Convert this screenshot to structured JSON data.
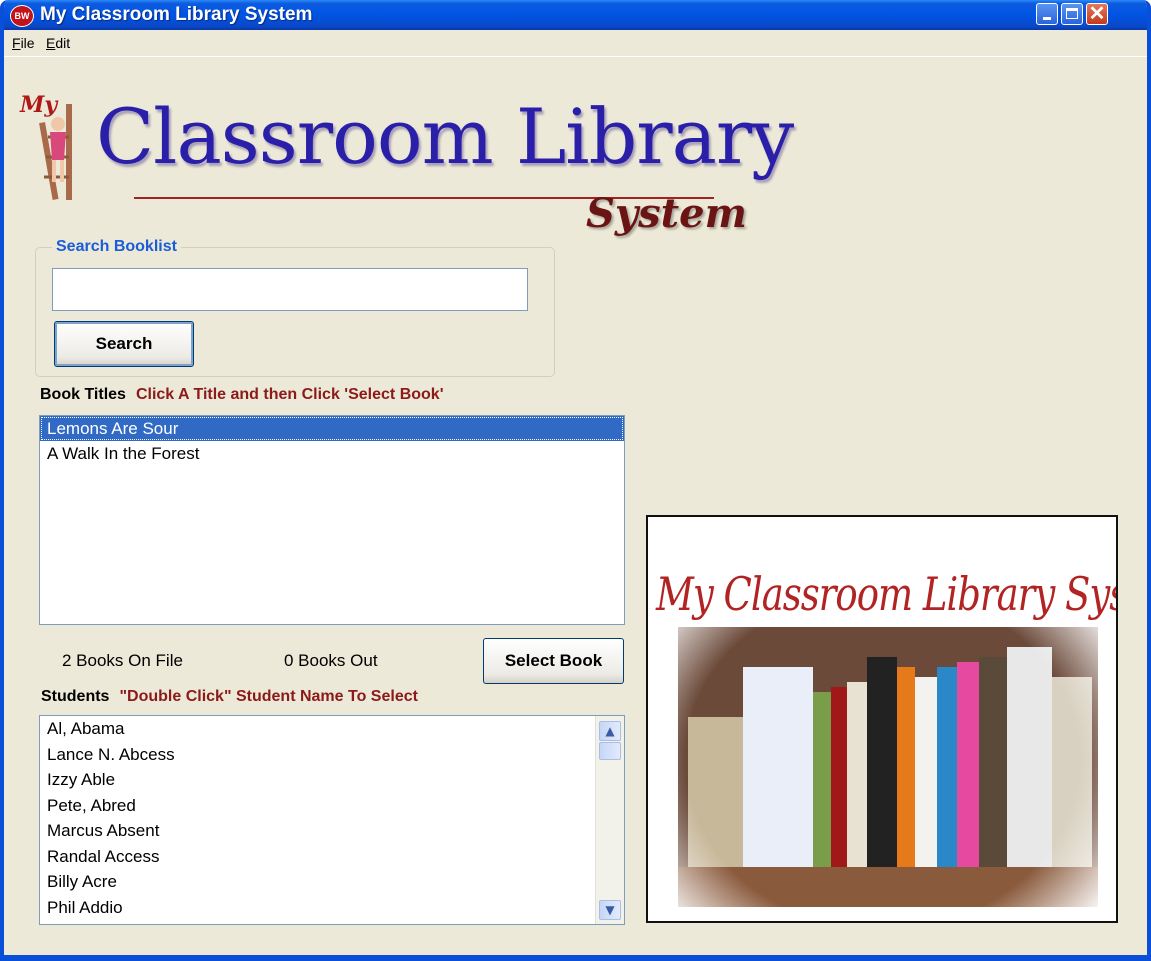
{
  "window": {
    "title": "My Classroom Library System",
    "icon_text": "BW",
    "controls": [
      "minimize",
      "maximize",
      "close"
    ]
  },
  "menu": {
    "file_accel": "F",
    "file_rest": "ile",
    "edit_accel": "E",
    "edit_rest": "dit"
  },
  "logo": {
    "my": "My",
    "main": "Classroom Library",
    "sub": "System"
  },
  "search": {
    "group_label": "Search Booklist",
    "input_value": "",
    "button_label": "Search"
  },
  "books": {
    "label": "Book Titles",
    "hint": "Click A Title and then Click 'Select Book'",
    "items": [
      "Lemons Are Sour",
      "A Walk In the Forest"
    ],
    "selected_index": 0,
    "on_file": "2 Books On File",
    "out": "0 Books Out",
    "select_button": "Select Book"
  },
  "students": {
    "label": "Students",
    "hint": "\"Double Click\" Student Name To Select",
    "items": [
      "Al, Abama",
      "Lance N. Abcess",
      "Izzy Able",
      "Pete, Abred",
      "Marcus Absent",
      "Randal Access",
      "Billy Acre",
      "Phil Addio"
    ]
  },
  "photo": {
    "caption": "My Classroom Library System"
  },
  "colors": {
    "titlebar": "#0054E3",
    "window_bg": "#ECE9D8",
    "selection": "#316AC5",
    "hint_text": "#8B1A1A",
    "group_label": "#1A5DD8",
    "logo_blue": "#2A1FA8",
    "logo_red": "#B22323"
  }
}
